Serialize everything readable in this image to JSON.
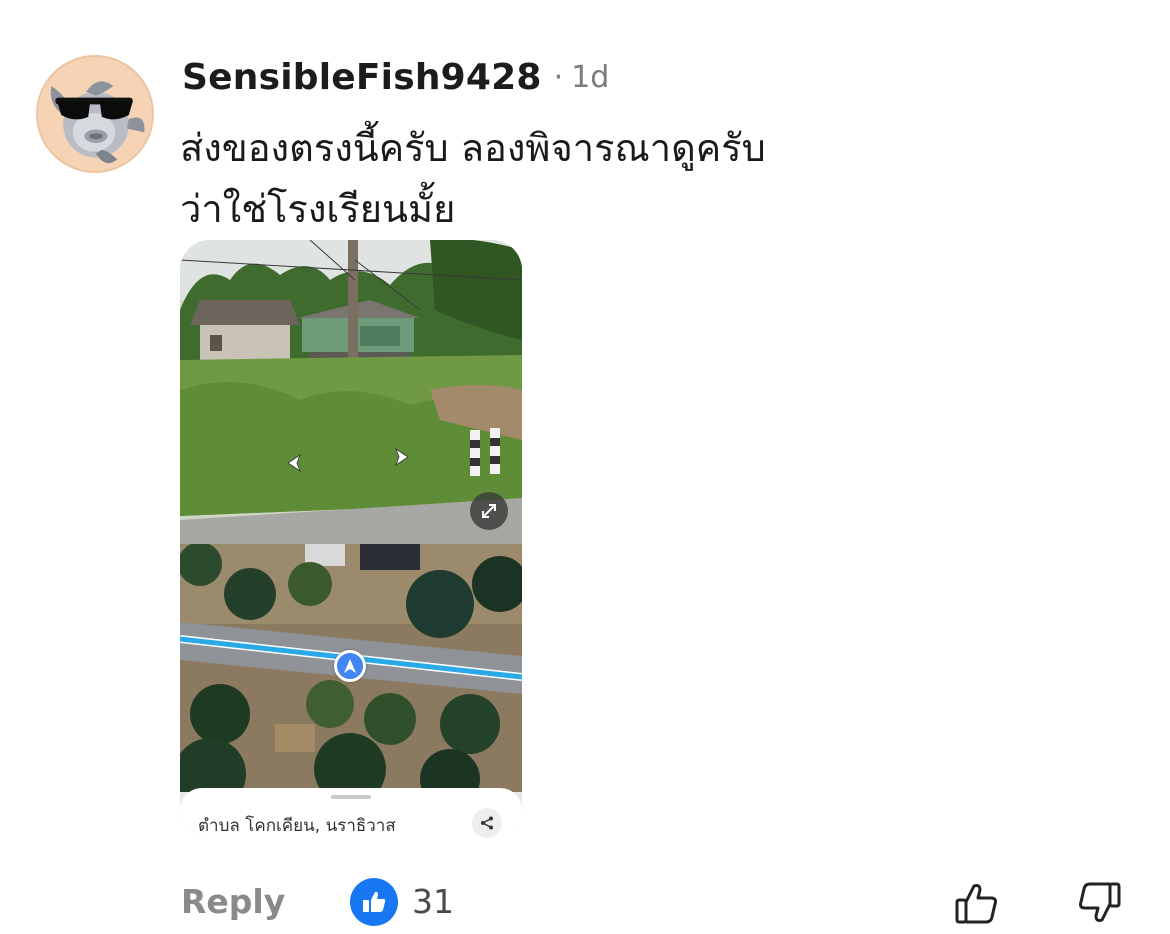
{
  "comment": {
    "author": "SensibleFish9428",
    "separator": "·",
    "time_ago": "1d",
    "text": "ส่งของตรงนี้ครับ ลองพิจารณาดูครับ\nว่าใช่โรงเรียนมั้ย"
  },
  "map_card": {
    "place_name": "ตำบล โคกเคียน, นราธิวาส",
    "icons": {
      "prev": "chevron-left-icon",
      "next": "chevron-right-icon",
      "expand": "expand-icon",
      "marker": "navigation-arrow-icon",
      "share": "share-icon"
    },
    "colors": {
      "marker": "#4285f4",
      "route": "#2aa9e8"
    }
  },
  "actions": {
    "reply_label": "Reply",
    "like_count": "31",
    "like_color": "#1877f2",
    "icons": {
      "like_reaction": "like-reaction-icon",
      "upvote": "thumbs-up-icon",
      "downvote": "thumbs-down-icon"
    }
  }
}
